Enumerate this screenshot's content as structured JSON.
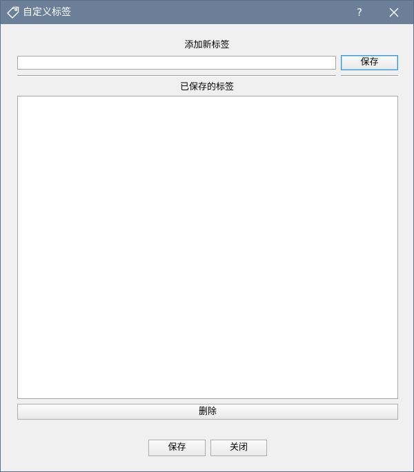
{
  "window": {
    "title": "自定义标签",
    "help": "?",
    "icons": {
      "app": "tag-icon",
      "close": "close-icon"
    }
  },
  "add_section": {
    "label": "添加新标签",
    "input_value": "",
    "input_placeholder": "",
    "save_label": "保存"
  },
  "saved_section": {
    "label": "已保存的标签",
    "items": [],
    "delete_label": "删除"
  },
  "footer": {
    "save_label": "保存",
    "close_label": "关闭"
  },
  "colors": {
    "titlebar": "#6b7f99",
    "focus_border": "#3c94d8"
  }
}
